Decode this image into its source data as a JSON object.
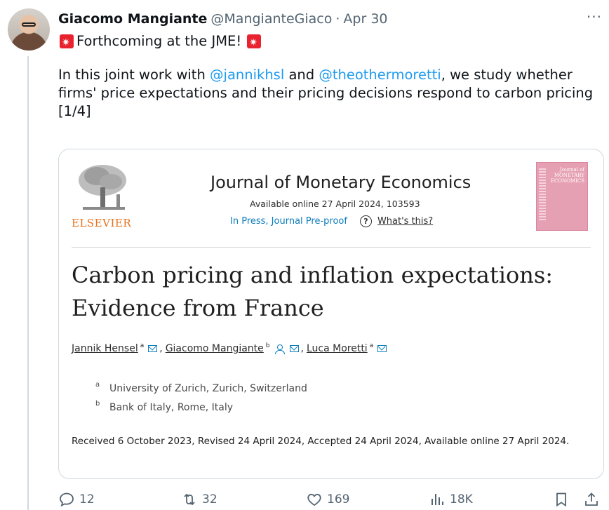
{
  "author": {
    "name": "Giacomo Mangiante",
    "handle": "@MangianteGiaco",
    "separator": "·",
    "date": "Apr 30"
  },
  "tweet": {
    "line1": "Forthcoming at the JME!",
    "intro": "In this joint work with",
    "mention1": "@jannikhsl",
    "and": "and",
    "mention2": "@theothermoretti",
    "rest": ", we study whether",
    "line3": "firms' price expectations and their pricing decisions respond to carbon pricing",
    "line4": "[1/4]"
  },
  "card": {
    "publisher": "ELSEVIER",
    "journal": "Journal of Monetary Economics",
    "available": "Available online 27 April 2024, 103593",
    "in_press": "In Press, Journal Pre-proof",
    "whats_this": "What's this?",
    "cover_title": "Journal of MONETARY ECONOMICS",
    "title_line1": "Carbon pricing and inflation expectations:",
    "title_line2": "Evidence from France",
    "authors": [
      {
        "name": "Jannik Hensel",
        "sup": "a"
      },
      {
        "name": "Giacomo Mangiante",
        "sup": "b"
      },
      {
        "name": "Luca Moretti",
        "sup": "a"
      }
    ],
    "comma": ",",
    "affiliations": [
      {
        "sup": "a",
        "text": "University of Zurich, Zurich, Switzerland"
      },
      {
        "sup": "b",
        "text": "Bank of Italy, Rome, Italy"
      }
    ],
    "received": "Received 6 October 2023, Revised 24 April 2024, Accepted 24 April 2024, Available online 27 April 2024."
  },
  "actions": {
    "replies": "12",
    "reposts": "32",
    "likes": "169",
    "views": "18K"
  },
  "colors": {
    "accent": "#1d9bf0",
    "siren": "#e8232f",
    "elsevier": "#e9711c",
    "link": "#0c7dbb"
  },
  "icons": [
    "more-icon",
    "siren-emoji",
    "question-icon",
    "email-icon",
    "person-icon",
    "reply-icon",
    "repost-icon",
    "like-icon",
    "views-icon",
    "bookmark-icon",
    "share-icon"
  ]
}
